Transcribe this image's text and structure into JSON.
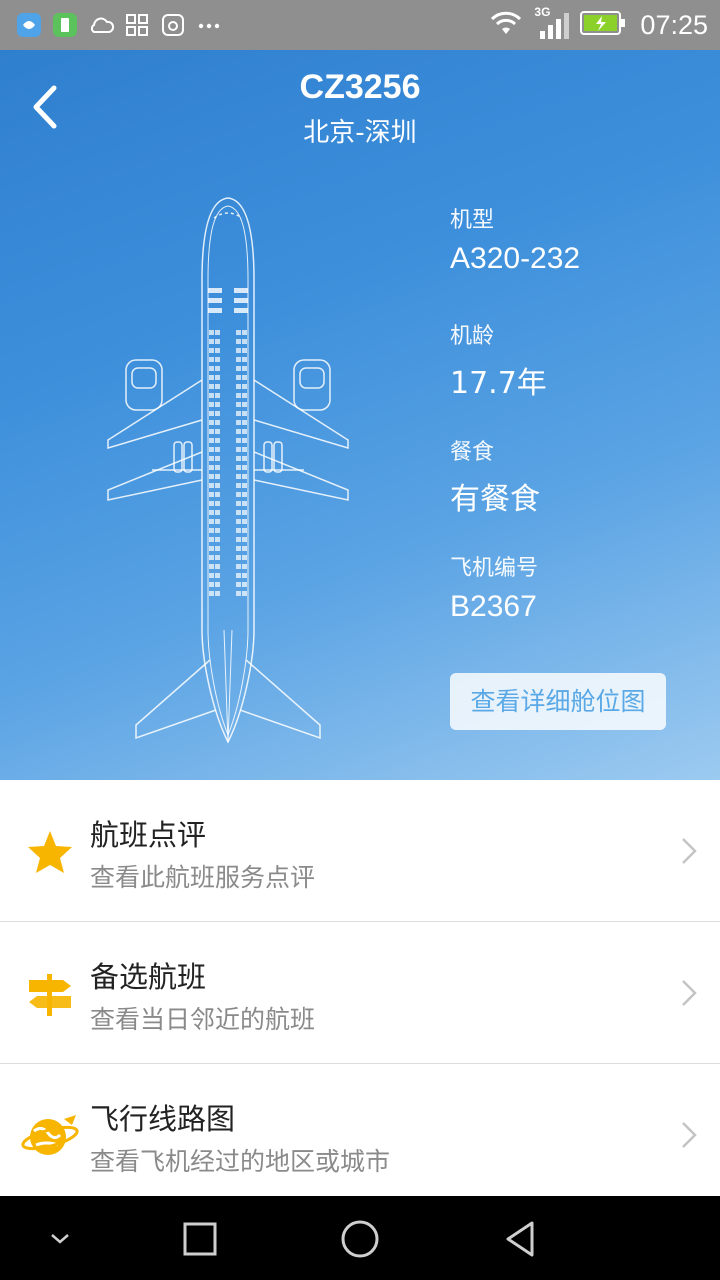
{
  "status_bar": {
    "time": "07:25",
    "network": "3G",
    "left_icons": [
      "app-notification-icon",
      "battery-app-icon",
      "weather-icon",
      "grid-icon",
      "shield-app-icon",
      "more-dots-icon"
    ]
  },
  "header": {
    "flight_number": "CZ3256",
    "route": "北京-深圳"
  },
  "aircraft_info": [
    {
      "label": "机型",
      "value": "A320-232"
    },
    {
      "label": "机龄",
      "value": "17.7年"
    },
    {
      "label": "餐食",
      "value": "有餐食"
    },
    {
      "label": "飞机编号",
      "value": "B2367"
    }
  ],
  "seat_map_button": "查看详细舱位图",
  "menu": [
    {
      "title": "航班点评",
      "subtitle": "查看此航班服务点评",
      "icon": "star-icon"
    },
    {
      "title": "备选航班",
      "subtitle": "查看当日邻近的航班",
      "icon": "signpost-icon"
    },
    {
      "title": "飞行线路图",
      "subtitle": "查看飞机经过的地区或城市",
      "icon": "globe-plane-icon"
    }
  ],
  "colors": {
    "header_gradient_start": "#2f7fcf",
    "header_gradient_end": "#9ccaf0",
    "icon_accent": "#f7b500",
    "button_text": "#5aa9e6"
  }
}
